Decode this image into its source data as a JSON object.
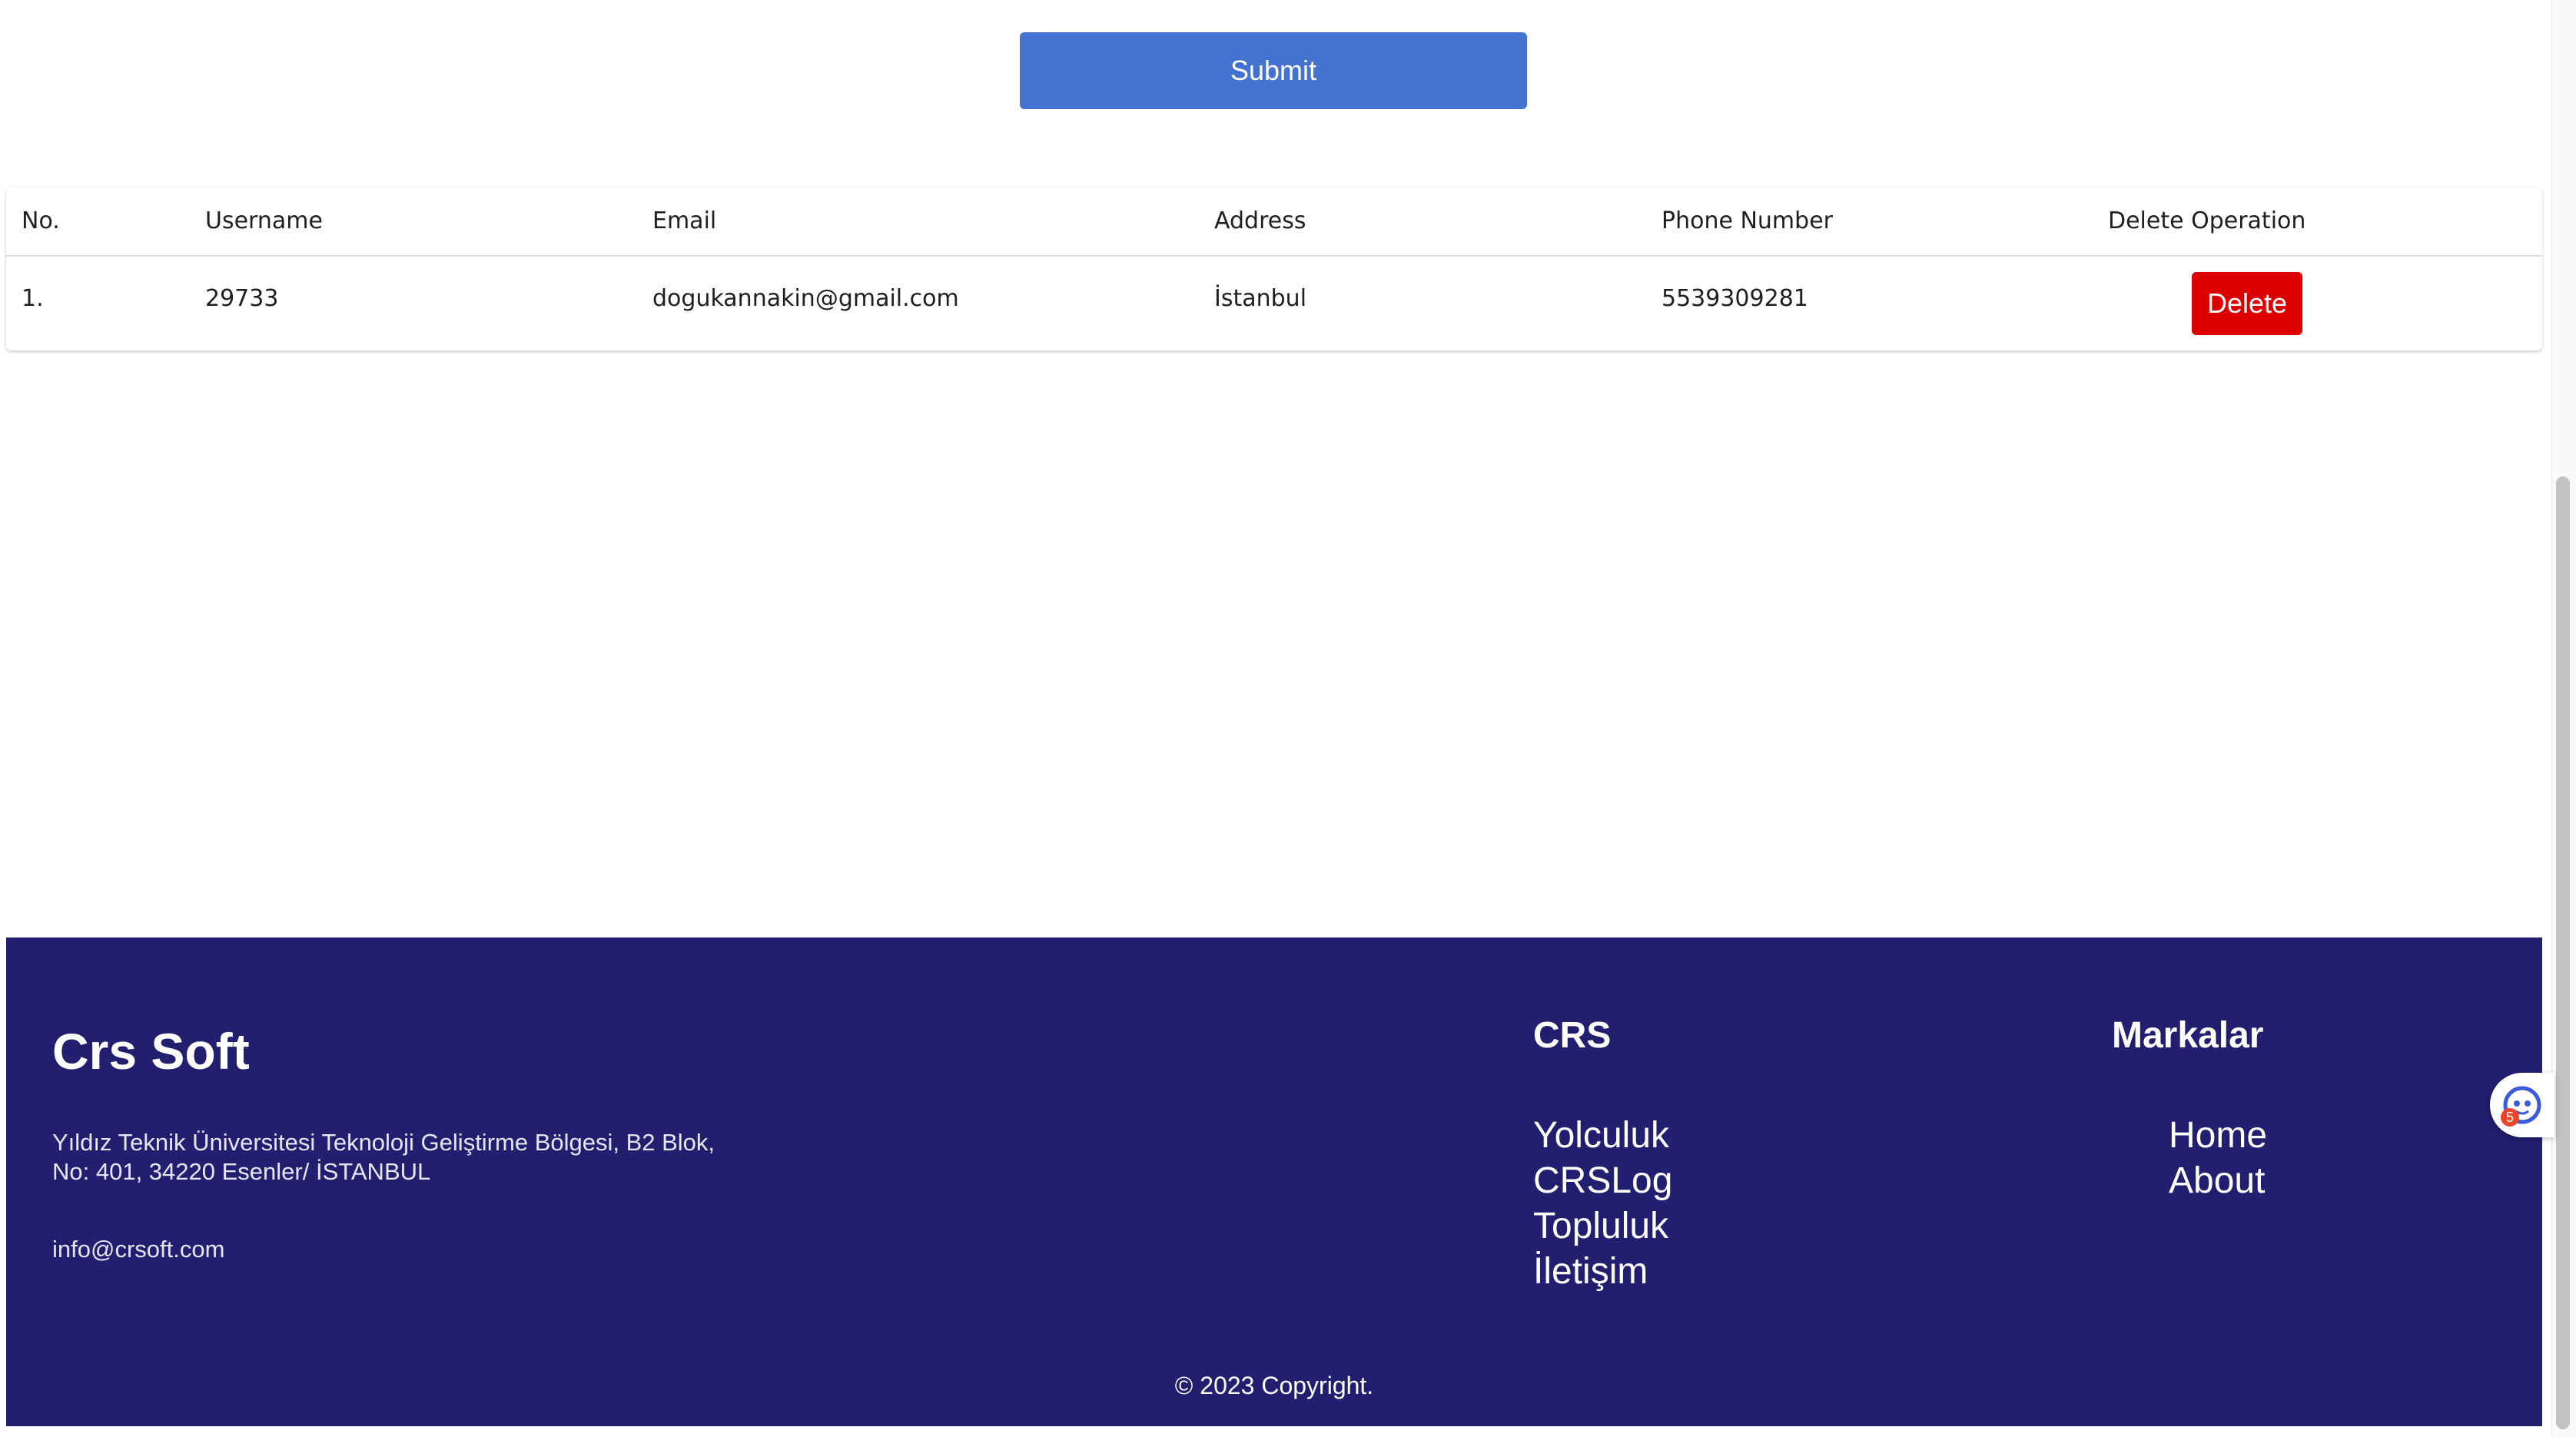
{
  "form": {
    "submit_label": "Submit"
  },
  "table": {
    "headers": [
      "No.",
      "Username",
      "Email",
      "Address",
      "Phone Number",
      "Delete Operation"
    ],
    "rows": [
      {
        "no": "1.",
        "username": "29733",
        "email": "dogukannakin@gmail.com",
        "address": "İstanbul",
        "phone": "5539309281",
        "delete_label": "Delete"
      }
    ]
  },
  "footer": {
    "brand": "Crs Soft",
    "address_line1": "Yıldız Teknik Üniversitesi Teknoloji Geliştirme Bölgesi, B2 Blok,",
    "address_line2": "No: 401, 34220 Esenler/ İSTANBUL",
    "email": "info@crsoft.com",
    "crs": {
      "title": "CRS",
      "links": [
        "Yolculuk",
        "CRSLog",
        "Topluluk",
        "İletişim"
      ]
    },
    "markalar": {
      "title": "Markalar",
      "links": [
        "Home",
        "About"
      ]
    },
    "copyright": "© 2023 Copyright."
  },
  "widget": {
    "icon": "assistant-icon",
    "badge": "5"
  },
  "colors": {
    "submit": "#4472d1",
    "delete": "#dd0000",
    "footer_bg": "#221e70"
  }
}
